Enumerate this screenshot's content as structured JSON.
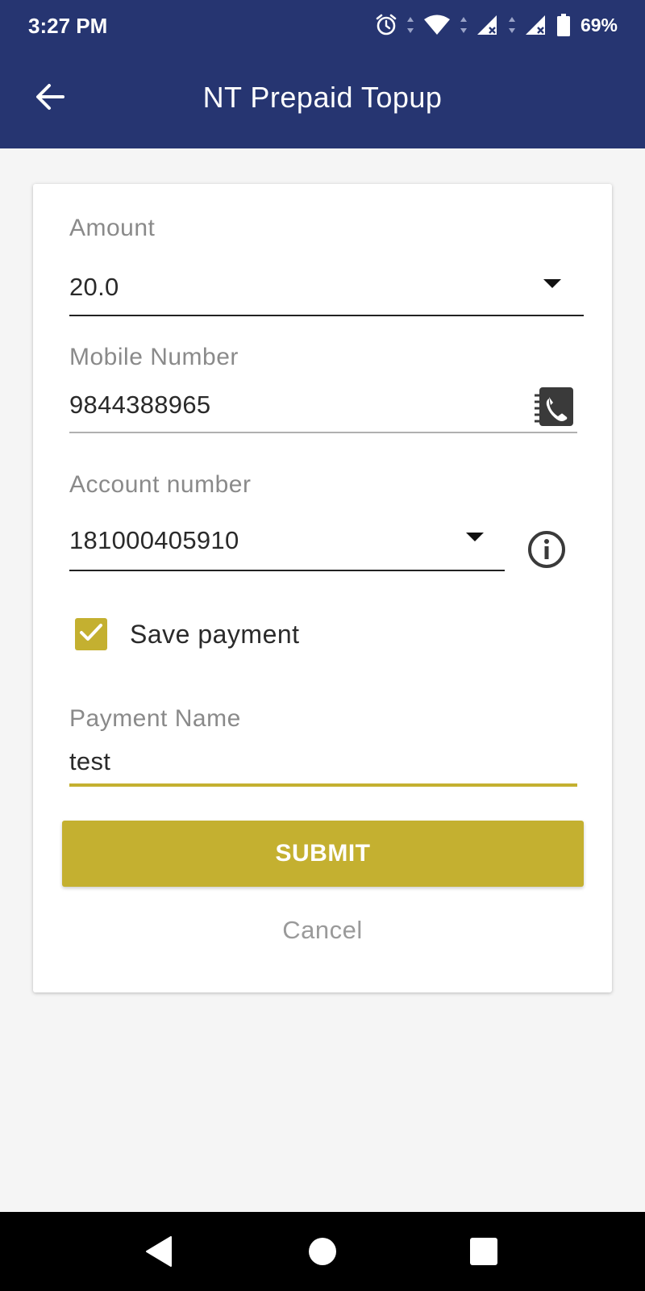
{
  "status_bar": {
    "time": "3:27 PM",
    "battery": "69%",
    "icons": [
      "alarm-icon",
      "wifi-icon",
      "signal-icon",
      "signal-icon",
      "battery-icon"
    ]
  },
  "app_bar": {
    "title": "NT Prepaid Topup",
    "back_icon": "arrow-back-icon"
  },
  "form": {
    "amount": {
      "label": "Amount",
      "value": "20.0"
    },
    "mobile": {
      "label": "Mobile Number",
      "value": "9844388965",
      "icon": "contact-book-icon"
    },
    "account": {
      "label": "Account number",
      "value": "181000405910",
      "icon": "info-icon"
    },
    "save_payment": {
      "label": "Save payment",
      "checked": true
    },
    "payment_name": {
      "label": "Payment Name",
      "value": "test"
    },
    "submit_label": "SUBMIT",
    "cancel_label": "Cancel"
  },
  "colors": {
    "primary": "#263571",
    "accent": "#c4b030",
    "background": "#f5f5f5"
  },
  "nav_bar": {
    "icons": [
      "back-triangle-icon",
      "home-circle-icon",
      "recents-square-icon"
    ]
  }
}
